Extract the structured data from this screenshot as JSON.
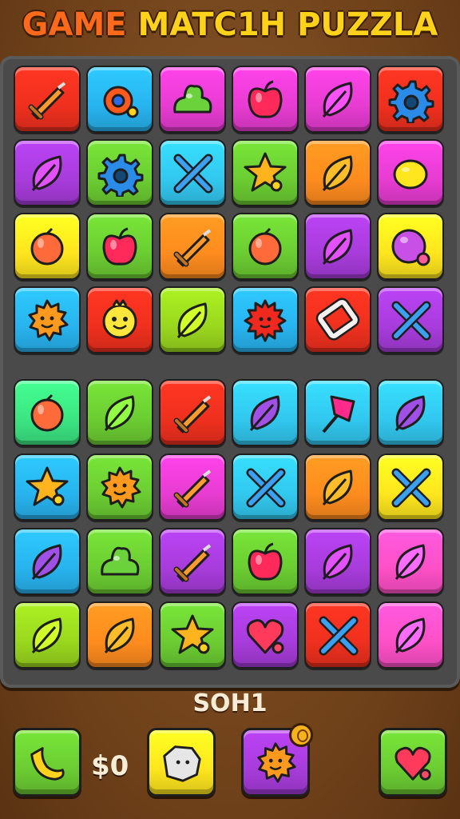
{
  "header": {
    "title_word1": "GAME",
    "title_rest": "MATC1H PUZZLA"
  },
  "score_label": "SOH1",
  "coins_label": "$0",
  "colors": {
    "red": "#f0301e",
    "blue": "#28b4f0",
    "magenta": "#e83cd2",
    "purple": "#a83cdc",
    "green": "#6ccd32",
    "orange": "#ff8c1e",
    "yellow": "#ffe61e",
    "cyan": "#32c8f0",
    "lime": "#9ad81e",
    "mint": "#3ce682",
    "pink": "#ff50c8",
    "board": "#4a4a4a",
    "wood": "#7a4a22"
  },
  "grid": {
    "rows": 8,
    "cols": 6,
    "tiles": [
      [
        "red:sword-icon",
        "blue:bomb-icon",
        "magenta:slime-icon",
        "magenta:apple-icon",
        "magenta:leaf-icon",
        "red:gear-icon"
      ],
      [
        "purple:leaf-icon",
        "green:gear-icon",
        "cyan:cross-swords-icon",
        "green:star-icon",
        "orange:leaf-icon",
        "magenta:lemon-icon"
      ],
      [
        "yellow:fruit-icon",
        "green:apple-icon",
        "orange:sword-icon",
        "green:fruit-icon",
        "purple:leaf-icon",
        "yellow:orb-icon"
      ],
      [
        "blue:sun-face-icon",
        "red:smiley-icon",
        "lime:leaf-icon",
        "blue:spiky-ball-icon",
        "red:ring-icon",
        "purple:cross-swords-icon"
      ],
      [
        "mint:fruit-icon",
        "green:leaf-icon",
        "red:sword-icon",
        "cyan:leaf-icon",
        "cyan:heart-flag-icon",
        "cyan:leaf-icon"
      ],
      [
        "blue:star-icon",
        "green:sun-face-icon",
        "magenta:sword-icon",
        "cyan:cross-swords-icon",
        "orange:leaf-icon",
        "yellow:cross-swords-icon"
      ],
      [
        "blue:leaf-icon",
        "green:slime-icon",
        "purple:sword-icon",
        "green:apple-icon",
        "purple:leaf-icon",
        "pink:leaf-icon"
      ],
      [
        "lime:leaf-icon",
        "orange:leaf-icon",
        "green:star-icon",
        "purple:heart-icon",
        "red:cross-swords-icon",
        "pink:leaf-icon"
      ]
    ]
  },
  "powerups": [
    {
      "color": "green",
      "icon": "banana-icon"
    },
    {
      "color": "yellow",
      "icon": "rock-icon"
    },
    {
      "color": "purple",
      "icon": "sun-face-icon"
    },
    {
      "color": "green",
      "icon": "heart-icon"
    }
  ]
}
